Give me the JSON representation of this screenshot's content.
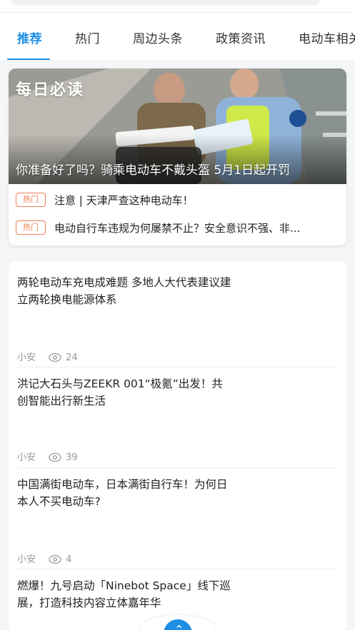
{
  "tabs": [
    {
      "label": "推荐",
      "active": true
    },
    {
      "label": "热门"
    },
    {
      "label": "周边头条"
    },
    {
      "label": "政策资讯"
    },
    {
      "label": "电动车相关"
    }
  ],
  "banner": {
    "brand": "每日必读",
    "caption": "你准备好了吗？骑乘电动车不戴头盔 5月1日起开罚"
  },
  "hot_items": [
    {
      "badge": "热门",
      "text": "注意 | 天津严查这种电动车！"
    },
    {
      "badge": "热门",
      "text": "电动自行车违规为何屡禁不止？安全意识不强、非..."
    }
  ],
  "articles": [
    {
      "title": "两轮电动车充电成难题 多地人大代表建议建立两轮换电能源体系",
      "author": "小安",
      "views": "24"
    },
    {
      "title": "洪记大石头与ZEEKR 001“极氪”出发！共创智能出行新生活",
      "author": "小安",
      "views": "39"
    },
    {
      "title": "中国满街电动车，日本满街自行车！为何日本人不买电动车?",
      "author": "小安",
      "views": "4"
    },
    {
      "title": "燃爆！九号启动「Ninebot Space」线下巡展，打造科技内容立体嘉年华",
      "author": "",
      "views": ""
    }
  ],
  "colors": {
    "accent": "#1f8fe6",
    "hot": "#f07b52"
  }
}
